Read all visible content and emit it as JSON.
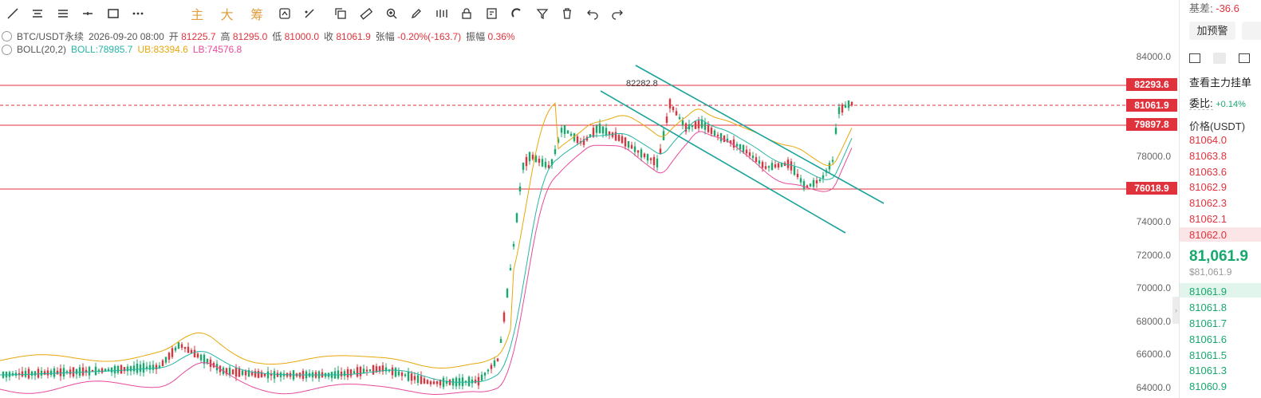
{
  "toolbar": {
    "text_buttons": [
      "主",
      "大",
      "筹"
    ]
  },
  "info": {
    "symbol": "BTC/USDT永续",
    "datetime": "2026-09-20 08:00",
    "open_label": "开",
    "open": "81225.7",
    "high_label": "高",
    "high": "81295.0",
    "low_label": "低",
    "low": "81000.0",
    "close_label": "收",
    "close": "81061.9",
    "change_label": "张幅",
    "change": "-0.20%(-163.7)",
    "amp_label": "振幅",
    "amp": "0.36%",
    "boll_label": "BOLL(20,2)",
    "boll": "BOLL:78985.7",
    "ub": "UB:83394.6",
    "lb": "LB:74576.8"
  },
  "axis_ticks": [
    "84000.0",
    "78000.0",
    "74000.0",
    "72000.0",
    "70000.0",
    "68000.0",
    "66000.0",
    "64000.0"
  ],
  "levels": [
    "82293.6",
    "81061.9",
    "79897.8",
    "76018.9"
  ],
  "annotation": "82282.8",
  "colors": {
    "up": "#17a86d",
    "down": "#e0323c",
    "ub": "#e8a80c",
    "mid": "#26b5a5",
    "lb": "#e84a9a",
    "channel": "#1aa39a"
  },
  "side": {
    "basis_label": "基差:",
    "basis_value": "-36.6",
    "alert_button": "加预警",
    "main_orders": "查看主力挂单",
    "ratio_label": "委比:",
    "ratio_value": "+0.14%",
    "price_header": "价格(USDT)",
    "asks": [
      "81064.0",
      "81063.8",
      "81063.6",
      "81062.9",
      "81062.3",
      "81062.1",
      "81062.0"
    ],
    "last_price": "81,061.9",
    "last_price_usd": "$81,061.9",
    "bids": [
      "81061.9",
      "81061.8",
      "81061.7",
      "81061.6",
      "81061.5",
      "81061.3",
      "81060.9"
    ]
  }
}
